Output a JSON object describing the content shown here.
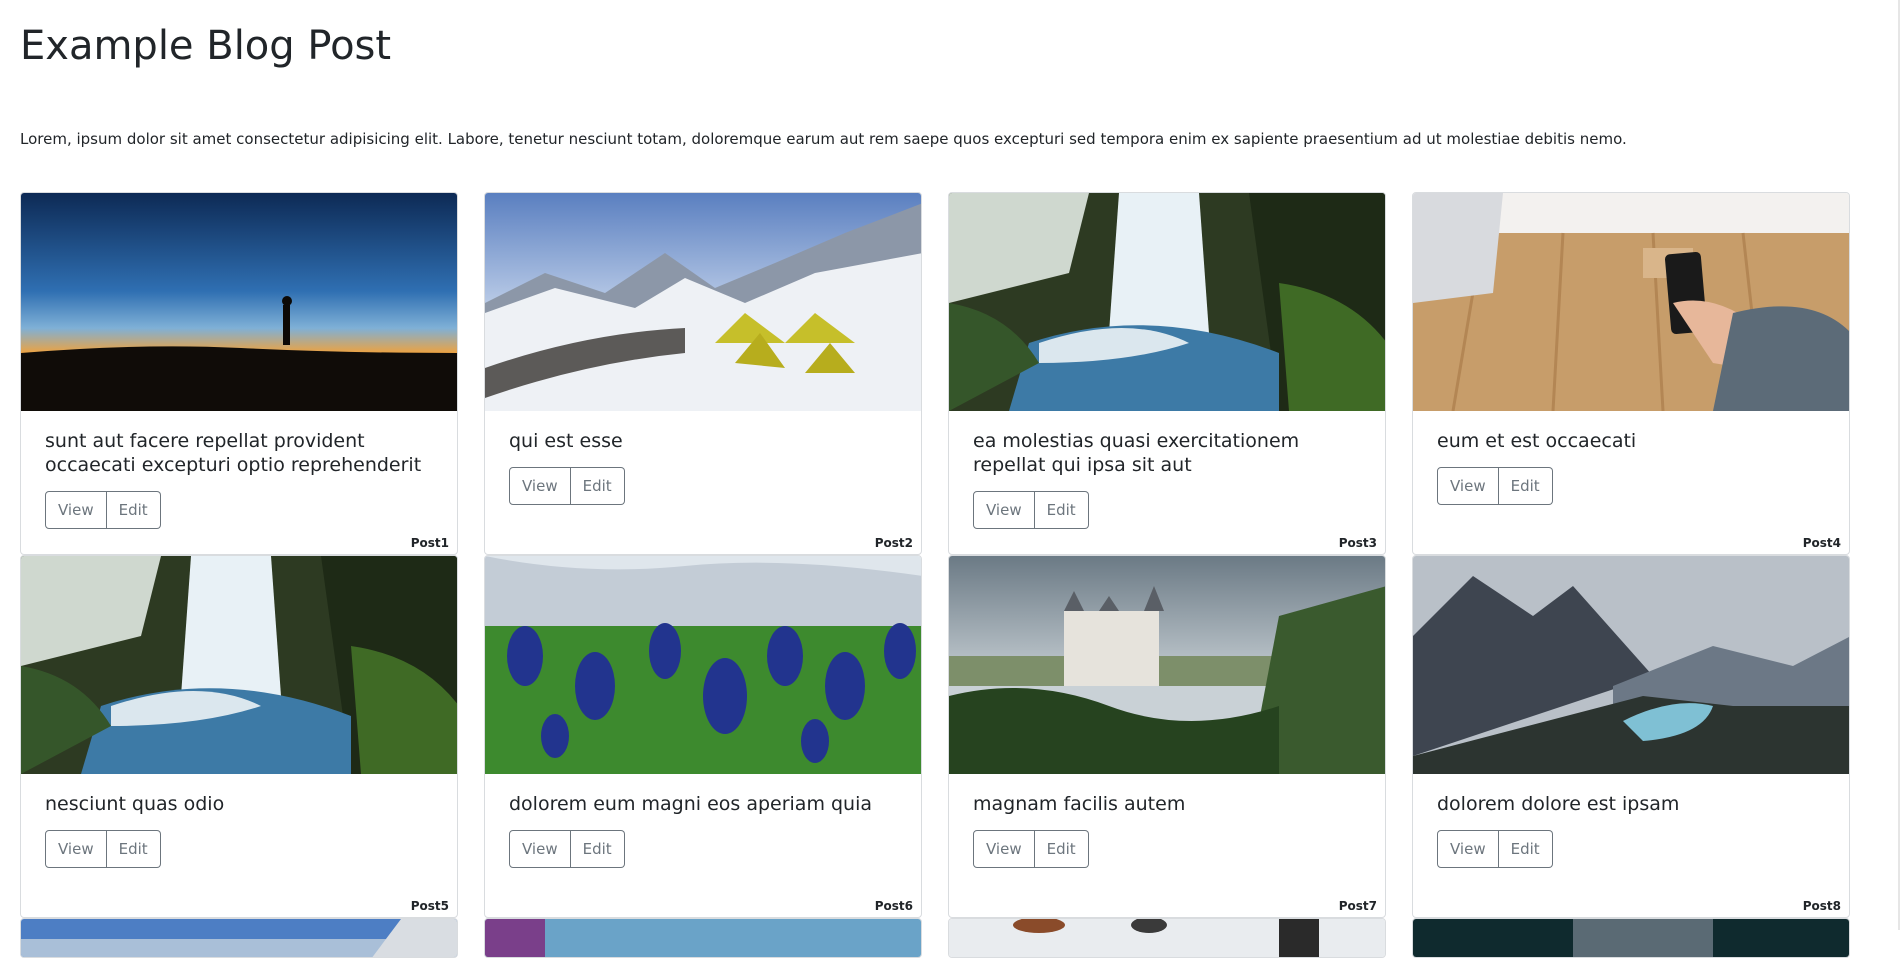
{
  "page": {
    "title": "Example Blog Post",
    "intro": "Lorem, ipsum dolor sit amet consectetur adipisicing elit. Labore, tenetur nesciunt totam, doloremque earum aut rem saepe quos excepturi sed tempora enim ex sapiente praesentium ad ut molestiae debitis nemo."
  },
  "buttons": {
    "view": "View",
    "edit": "Edit"
  },
  "posts": [
    {
      "title": "sunt aut facere repellat provident occaecati excepturi optio reprehenderit",
      "tag": "Post1",
      "image": "silhouette-sunset"
    },
    {
      "title": "qui est esse",
      "tag": "Post2",
      "image": "snowy-mountain-tents"
    },
    {
      "title": "ea molestias quasi exercitationem repellat qui ipsa sit aut",
      "tag": "Post3",
      "image": "waterfall"
    },
    {
      "title": "eum et est occaecati",
      "tag": "Post4",
      "image": "hand-phone-table"
    },
    {
      "title": "nesciunt quas odio",
      "tag": "Post5",
      "image": "waterfall"
    },
    {
      "title": "dolorem eum magni eos aperiam quia",
      "tag": "Post6",
      "image": "bluebonnet-flowers"
    },
    {
      "title": "magnam facilis autem",
      "tag": "Post7",
      "image": "castle-forest"
    },
    {
      "title": "dolorem dolore est ipsam",
      "tag": "Post8",
      "image": "mountain-lake"
    }
  ],
  "partial_row_images": [
    "mountain-sky",
    "rainbow-sky",
    "cafe-interior",
    "dark-tunnel"
  ]
}
